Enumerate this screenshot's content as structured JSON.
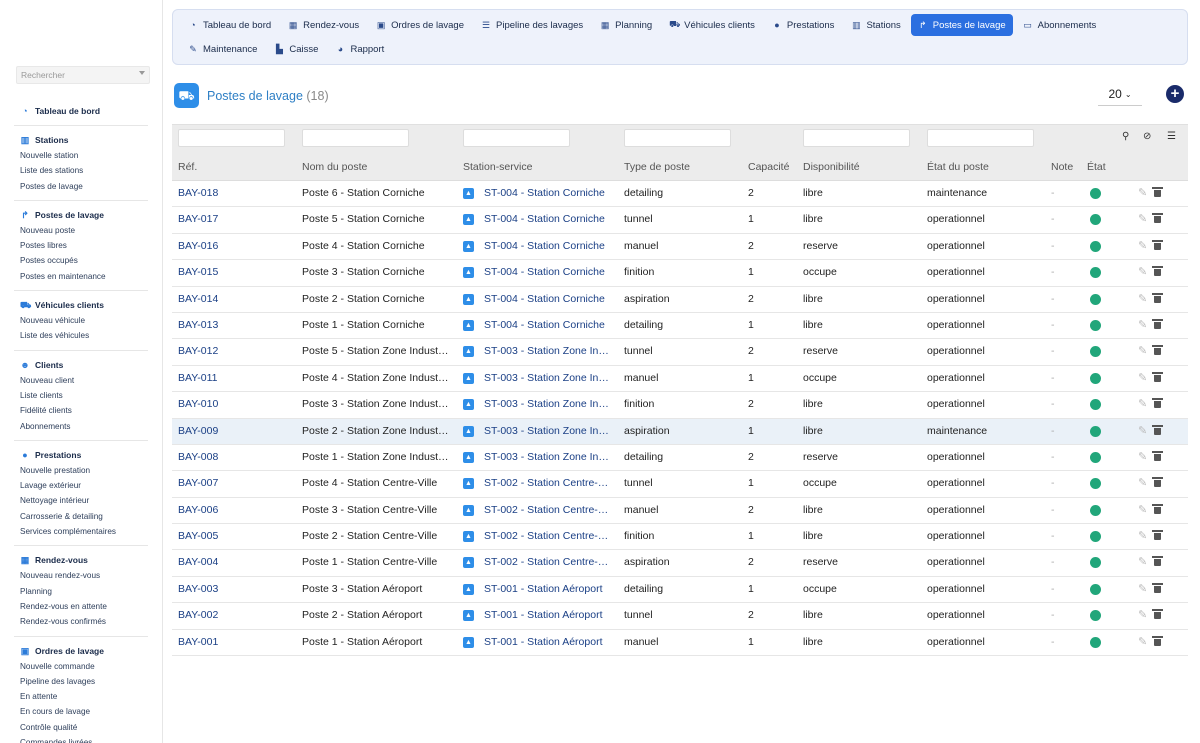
{
  "sidebar": {
    "search_placeholder": "Rechercher",
    "sections": [
      {
        "title": "Tableau de bord",
        "icon": "dashboard-icon",
        "items": []
      },
      {
        "title": "Stations",
        "icon": "building-icon",
        "items": [
          "Nouvelle station",
          "Liste des stations",
          "Postes de lavage"
        ]
      },
      {
        "title": "Postes de lavage",
        "icon": "bay-icon",
        "items": [
          "Nouveau poste",
          "Postes libres",
          "Postes occupés",
          "Postes en maintenance"
        ]
      },
      {
        "title": "Véhicules clients",
        "icon": "car-icon",
        "items": [
          "Nouveau véhicule",
          "Liste des véhicules"
        ]
      },
      {
        "title": "Clients",
        "icon": "users-icon",
        "items": [
          "Nouveau client",
          "Liste clients",
          "Fidélité clients",
          "Abonnements"
        ]
      },
      {
        "title": "Prestations",
        "icon": "drop-icon",
        "items": [
          "Nouvelle prestation",
          "Lavage extérieur",
          "Nettoyage intérieur",
          "Carrosserie & detailing",
          "Services complémentaires"
        ]
      },
      {
        "title": "Rendez-vous",
        "icon": "calendar-icon",
        "items": [
          "Nouveau rendez-vous",
          "Planning",
          "Rendez-vous en attente",
          "Rendez-vous confirmés"
        ]
      },
      {
        "title": "Ordres de lavage",
        "icon": "clipboard-icon",
        "items": [
          "Nouvelle commande",
          "Pipeline des lavages",
          "En attente",
          "En cours de lavage",
          "Contrôle qualité",
          "Commandes livrées"
        ]
      }
    ]
  },
  "topnav": {
    "items": [
      {
        "label": "Tableau de bord",
        "glyph": "◔",
        "icon": "dashboard-icon",
        "active": false
      },
      {
        "label": "Rendez-vous",
        "glyph": "▦",
        "icon": "calendar-icon",
        "active": false
      },
      {
        "label": "Ordres de lavage",
        "glyph": "▣",
        "icon": "clipboard-icon",
        "active": false
      },
      {
        "label": "Pipeline des lavages",
        "glyph": "☰",
        "icon": "pipeline-icon",
        "active": false
      },
      {
        "label": "Planning",
        "glyph": "▦",
        "icon": "calendar-icon",
        "active": false
      },
      {
        "label": "Véhicules clients",
        "glyph": "⛟",
        "icon": "car-icon",
        "active": false
      },
      {
        "label": "Prestations",
        "glyph": "●",
        "icon": "drop-icon",
        "active": false
      },
      {
        "label": "Stations",
        "glyph": "▥",
        "icon": "building-icon",
        "active": false
      },
      {
        "label": "Postes de lavage",
        "glyph": "↱",
        "icon": "bay-icon",
        "active": true
      },
      {
        "label": "Abonnements",
        "glyph": "▭",
        "icon": "card-icon",
        "active": false
      },
      {
        "label": "Maintenance",
        "glyph": "✎",
        "icon": "wrench-icon",
        "active": false
      },
      {
        "label": "Caisse",
        "glyph": "▙",
        "icon": "cash-icon",
        "active": false
      },
      {
        "label": "Rapport",
        "glyph": "◕",
        "icon": "report-icon",
        "active": false
      }
    ]
  },
  "header": {
    "title": "Postes de lavage",
    "count": "(18)",
    "page_size": "20",
    "add_label": "+"
  },
  "table": {
    "columns": [
      "Réf.",
      "Nom du poste",
      "Station-service",
      "Type de poste",
      "Capacité",
      "Disponibilité",
      "État du poste",
      "Note",
      "État"
    ],
    "rows": [
      {
        "ref": "BAY-018",
        "name": "Poste 6 - Station Corniche",
        "station": "ST-004 - Station Corniche",
        "type": "detailing",
        "capacity": "2",
        "availability": "libre",
        "state": "maintenance",
        "note": "-"
      },
      {
        "ref": "BAY-017",
        "name": "Poste 5 - Station Corniche",
        "station": "ST-004 - Station Corniche",
        "type": "tunnel",
        "capacity": "1",
        "availability": "libre",
        "state": "operationnel",
        "note": "-"
      },
      {
        "ref": "BAY-016",
        "name": "Poste 4 - Station Corniche",
        "station": "ST-004 - Station Corniche",
        "type": "manuel",
        "capacity": "2",
        "availability": "reserve",
        "state": "operationnel",
        "note": "-"
      },
      {
        "ref": "BAY-015",
        "name": "Poste 3 - Station Corniche",
        "station": "ST-004 - Station Corniche",
        "type": "finition",
        "capacity": "1",
        "availability": "occupe",
        "state": "operationnel",
        "note": "-"
      },
      {
        "ref": "BAY-014",
        "name": "Poste 2 - Station Corniche",
        "station": "ST-004 - Station Corniche",
        "type": "aspiration",
        "capacity": "2",
        "availability": "libre",
        "state": "operationnel",
        "note": "-"
      },
      {
        "ref": "BAY-013",
        "name": "Poste 1 - Station Corniche",
        "station": "ST-004 - Station Corniche",
        "type": "detailing",
        "capacity": "1",
        "availability": "libre",
        "state": "operationnel",
        "note": "-"
      },
      {
        "ref": "BAY-012",
        "name": "Poste 5 - Station Zone Indust…",
        "station": "ST-003 - Station Zone In…",
        "type": "tunnel",
        "capacity": "2",
        "availability": "reserve",
        "state": "operationnel",
        "note": "-"
      },
      {
        "ref": "BAY-011",
        "name": "Poste 4 - Station Zone Indust…",
        "station": "ST-003 - Station Zone In…",
        "type": "manuel",
        "capacity": "1",
        "availability": "occupe",
        "state": "operationnel",
        "note": "-"
      },
      {
        "ref": "BAY-010",
        "name": "Poste 3 - Station Zone Indust…",
        "station": "ST-003 - Station Zone In…",
        "type": "finition",
        "capacity": "2",
        "availability": "libre",
        "state": "operationnel",
        "note": "-"
      },
      {
        "ref": "BAY-009",
        "name": "Poste 2 - Station Zone Indust…",
        "station": "ST-003 - Station Zone In…",
        "type": "aspiration",
        "capacity": "1",
        "availability": "libre",
        "state": "maintenance",
        "note": "-"
      },
      {
        "ref": "BAY-008",
        "name": "Poste 1 - Station Zone Indust…",
        "station": "ST-003 - Station Zone In…",
        "type": "detailing",
        "capacity": "2",
        "availability": "reserve",
        "state": "operationnel",
        "note": "-"
      },
      {
        "ref": "BAY-007",
        "name": "Poste 4 - Station Centre-Ville",
        "station": "ST-002 - Station Centre-…",
        "type": "tunnel",
        "capacity": "1",
        "availability": "occupe",
        "state": "operationnel",
        "note": "-"
      },
      {
        "ref": "BAY-006",
        "name": "Poste 3 - Station Centre-Ville",
        "station": "ST-002 - Station Centre-…",
        "type": "manuel",
        "capacity": "2",
        "availability": "libre",
        "state": "operationnel",
        "note": "-"
      },
      {
        "ref": "BAY-005",
        "name": "Poste 2 - Station Centre-Ville",
        "station": "ST-002 - Station Centre-…",
        "type": "finition",
        "capacity": "1",
        "availability": "libre",
        "state": "operationnel",
        "note": "-"
      },
      {
        "ref": "BAY-004",
        "name": "Poste 1 - Station Centre-Ville",
        "station": "ST-002 - Station Centre-…",
        "type": "aspiration",
        "capacity": "2",
        "availability": "reserve",
        "state": "operationnel",
        "note": "-"
      },
      {
        "ref": "BAY-003",
        "name": "Poste 3 - Station Aéroport",
        "station": "ST-001 - Station Aéroport",
        "type": "detailing",
        "capacity": "1",
        "availability": "occupe",
        "state": "operationnel",
        "note": "-"
      },
      {
        "ref": "BAY-002",
        "name": "Poste 2 - Station Aéroport",
        "station": "ST-001 - Station Aéroport",
        "type": "tunnel",
        "capacity": "2",
        "availability": "libre",
        "state": "operationnel",
        "note": "-"
      },
      {
        "ref": "BAY-001",
        "name": "Poste 1 - Station Aéroport",
        "station": "ST-001 - Station Aéroport",
        "type": "manuel",
        "capacity": "1",
        "availability": "libre",
        "state": "operationnel",
        "note": "-"
      }
    ],
    "highlighted_row": 9,
    "status_color": "#21a67a"
  },
  "colors": {
    "accent": "#2b6fe0",
    "link": "#1a3f85",
    "title": "#2e7fc5"
  }
}
